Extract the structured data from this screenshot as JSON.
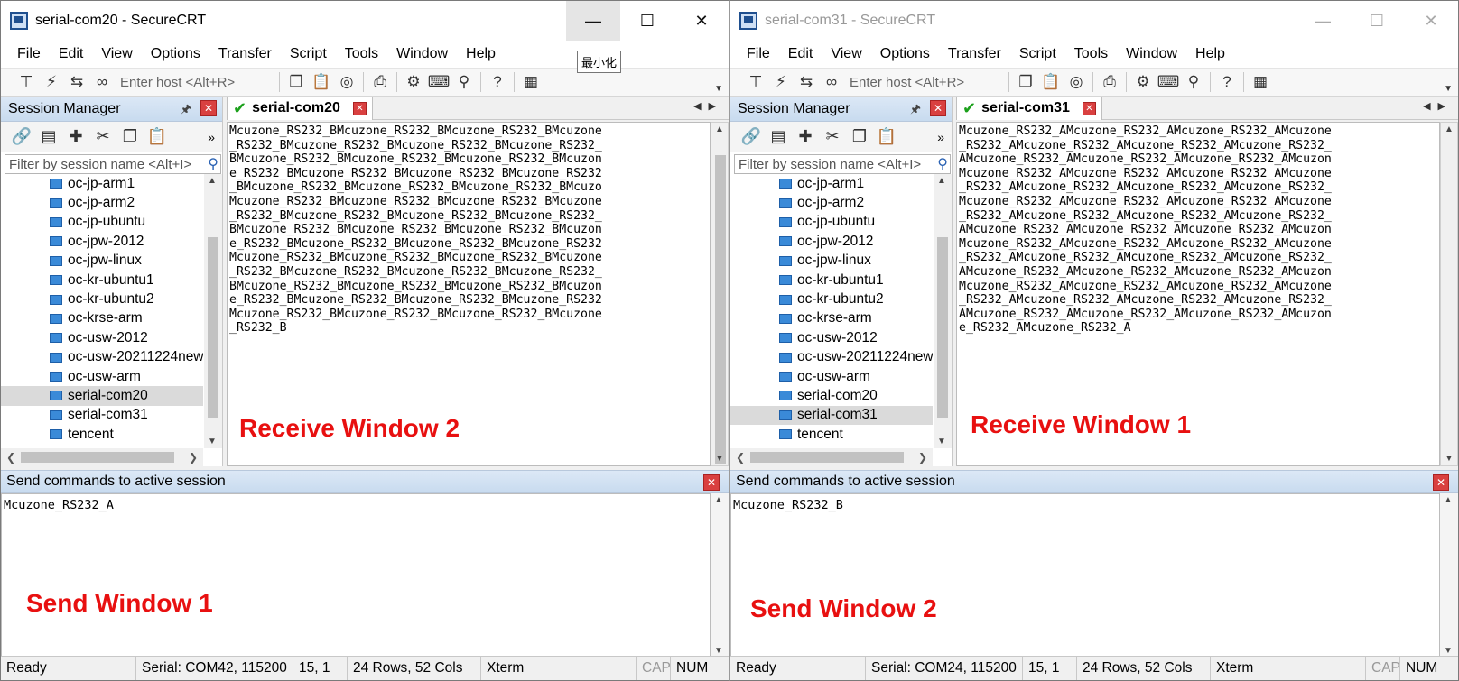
{
  "tooltip": "最小化",
  "windows": [
    {
      "title": "serial-com20 - SecureCRT",
      "menu": [
        "File",
        "Edit",
        "View",
        "Options",
        "Transfer",
        "Script",
        "Tools",
        "Window",
        "Help"
      ],
      "host_placeholder": "Enter host <Alt+R>",
      "session_manager": {
        "title": "Session Manager",
        "filter_placeholder": "Filter by session name <Alt+I>",
        "items": [
          "oc-jp-arm1",
          "oc-jp-arm2",
          "oc-jp-ubuntu",
          "oc-jpw-2012",
          "oc-jpw-linux",
          "oc-kr-ubuntu1",
          "oc-kr-ubuntu2",
          "oc-krse-arm",
          "oc-usw-2012",
          "oc-usw-20211224new",
          "oc-usw-arm",
          "serial-com20",
          "serial-com31",
          "tencent"
        ],
        "selected": "serial-com20"
      },
      "tab": "serial-com20",
      "terminal_lines": [
        "Mcuzone_RS232_BMcuzone_RS232_BMcuzone_RS232_BMcuzone",
        "_RS232_BMcuzone_RS232_BMcuzone_RS232_BMcuzone_RS232_",
        "BMcuzone_RS232_BMcuzone_RS232_BMcuzone_RS232_BMcuzon",
        "e_RS232_BMcuzone_RS232_BMcuzone_RS232_BMcuzone_RS232",
        "_BMcuzone_RS232_BMcuzone_RS232_BMcuzone_RS232_BMcuzo",
        "Mcuzone_RS232_BMcuzone_RS232_BMcuzone_RS232_BMcuzone",
        "_RS232_BMcuzone_RS232_BMcuzone_RS232_BMcuzone_RS232_",
        "BMcuzone_RS232_BMcuzone_RS232_BMcuzone_RS232_BMcuzon",
        "e_RS232_BMcuzone_RS232_BMcuzone_RS232_BMcuzone_RS232",
        "Mcuzone_RS232_BMcuzone_RS232_BMcuzone_RS232_BMcuzone",
        "_RS232_BMcuzone_RS232_BMcuzone_RS232_BMcuzone_RS232_",
        "BMcuzone_RS232_BMcuzone_RS232_BMcuzone_RS232_BMcuzon",
        "e_RS232_BMcuzone_RS232_BMcuzone_RS232_BMcuzone_RS232",
        "Mcuzone_RS232_BMcuzone_RS232_BMcuzone_RS232_BMcuzone",
        "_RS232_B"
      ],
      "receive_label": "Receive Window 2",
      "send_panel_title": "Send commands to active session",
      "send_text": "Mcuzone_RS232_A",
      "send_label": "Send Window 1",
      "status": {
        "state": "Ready",
        "serial": "Serial: COM42, 115200",
        "pos": "15,   1",
        "size": "24 Rows, 52 Cols",
        "term": "Xterm",
        "cap": "CAP",
        "num": "NUM"
      }
    },
    {
      "title": "serial-com31 - SecureCRT",
      "menu": [
        "File",
        "Edit",
        "View",
        "Options",
        "Transfer",
        "Script",
        "Tools",
        "Window",
        "Help"
      ],
      "host_placeholder": "Enter host <Alt+R>",
      "session_manager": {
        "title": "Session Manager",
        "filter_placeholder": "Filter by session name <Alt+I>",
        "items": [
          "oc-jp-arm1",
          "oc-jp-arm2",
          "oc-jp-ubuntu",
          "oc-jpw-2012",
          "oc-jpw-linux",
          "oc-kr-ubuntu1",
          "oc-kr-ubuntu2",
          "oc-krse-arm",
          "oc-usw-2012",
          "oc-usw-20211224new",
          "oc-usw-arm",
          "serial-com20",
          "serial-com31",
          "tencent"
        ],
        "selected": "serial-com31"
      },
      "tab": "serial-com31",
      "terminal_lines": [
        "Mcuzone_RS232_AMcuzone_RS232_AMcuzone_RS232_AMcuzone",
        "_RS232_AMcuzone_RS232_AMcuzone_RS232_AMcuzone_RS232_",
        "AMcuzone_RS232_AMcuzone_RS232_AMcuzone_RS232_AMcuzon",
        "Mcuzone_RS232_AMcuzone_RS232_AMcuzone_RS232_AMcuzone",
        "_RS232_AMcuzone_RS232_AMcuzone_RS232_AMcuzone_RS232_",
        "Mcuzone_RS232_AMcuzone_RS232_AMcuzone_RS232_AMcuzone",
        "_RS232_AMcuzone_RS232_AMcuzone_RS232_AMcuzone_RS232_",
        "AMcuzone_RS232_AMcuzone_RS232_AMcuzone_RS232_AMcuzon",
        "Mcuzone_RS232_AMcuzone_RS232_AMcuzone_RS232_AMcuzone",
        "_RS232_AMcuzone_RS232_AMcuzone_RS232_AMcuzone_RS232_",
        "AMcuzone_RS232_AMcuzone_RS232_AMcuzone_RS232_AMcuzon",
        "Mcuzone_RS232_AMcuzone_RS232_AMcuzone_RS232_AMcuzone",
        "_RS232_AMcuzone_RS232_AMcuzone_RS232_AMcuzone_RS232_",
        "AMcuzone_RS232_AMcuzone_RS232_AMcuzone_RS232_AMcuzon",
        "e_RS232_AMcuzone_RS232_A"
      ],
      "receive_label": "Receive Window 1",
      "send_panel_title": "Send commands to active session",
      "send_text": "Mcuzone_RS232_B",
      "send_label": "Send Window 2",
      "status": {
        "state": "Ready",
        "serial": "Serial: COM24, 115200",
        "pos": "15,   1",
        "size": "24 Rows, 52 Cols",
        "term": "Xterm",
        "cap": "CAP",
        "num": "NUM"
      }
    }
  ]
}
